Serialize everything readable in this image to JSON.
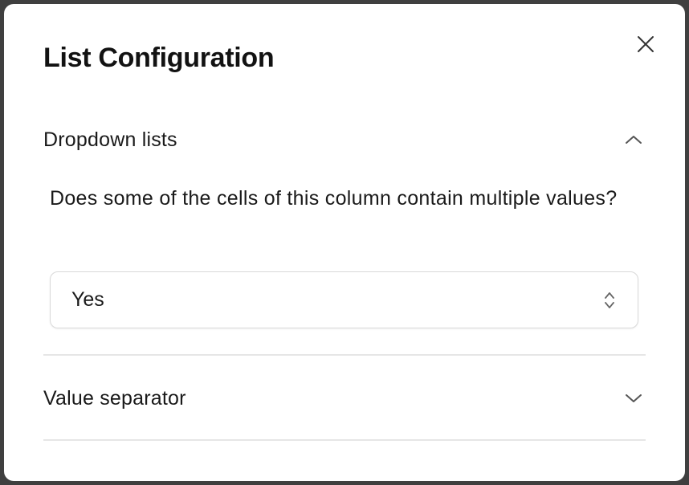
{
  "dialog": {
    "title": "List Configuration"
  },
  "sections": [
    {
      "label": "Dropdown lists",
      "expanded": true,
      "chevron_icon": "chevron-up-icon"
    },
    {
      "label": "Value separator",
      "expanded": false,
      "chevron_icon": "chevron-down-icon"
    }
  ],
  "dropdown_lists": {
    "question": "Does some of the cells of this column contain multiple values?",
    "select": {
      "value": "Yes",
      "icon": "up-down-chevrons-icon"
    }
  },
  "icons": {
    "close": "close-icon"
  },
  "colors": {
    "backdrop": "#3f3f3f",
    "surface": "#ffffff",
    "text": "#1a1a1a",
    "divider": "#e6e6e6",
    "border": "#d9d9d9"
  }
}
